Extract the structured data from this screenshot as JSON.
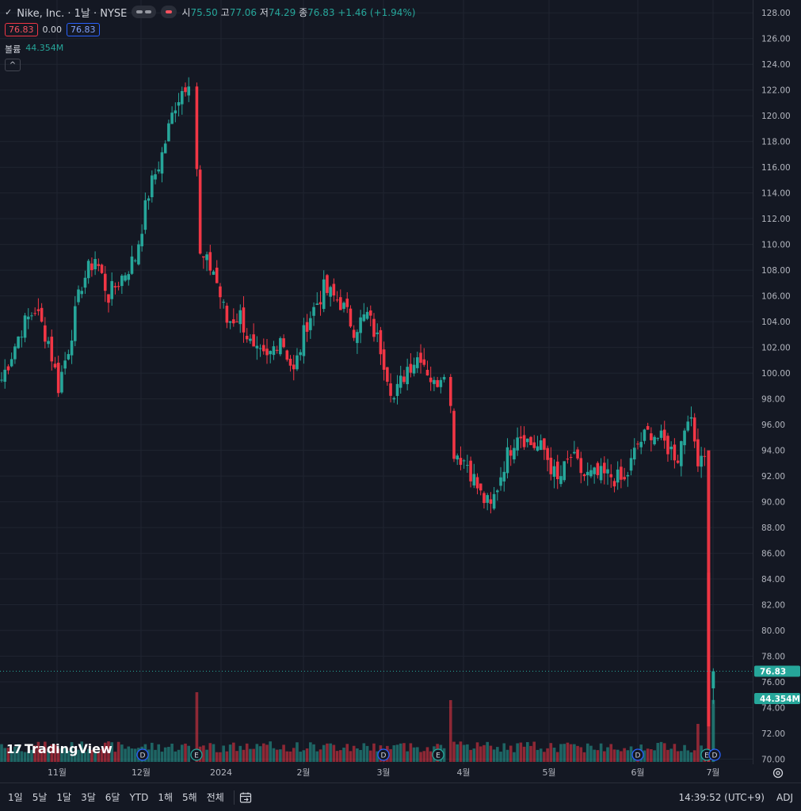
{
  "header": {
    "title": "Nike, Inc. · 1날 · NYSE",
    "ohlc": [
      {
        "k": "시",
        "v": "75.50"
      },
      {
        "k": "고",
        "v": "77.06"
      },
      {
        "k": "저",
        "v": "74.29"
      },
      {
        "k": "종",
        "v": "76.83"
      }
    ],
    "change": "+1.46 (+1.94%)",
    "bid": "76.83",
    "spread": "0.00",
    "ask": "76.83",
    "volume_label": "볼륨",
    "volume_value": "44.354M",
    "collapse_glyph": "^"
  },
  "colors": {
    "up": "#26a69a",
    "down": "#f23645",
    "background": "#141823",
    "grid": "#1f2430"
  },
  "price_axis": {
    "ticks": [
      "128.00",
      "126.00",
      "124.00",
      "122.00",
      "120.00",
      "118.00",
      "116.00",
      "114.00",
      "112.00",
      "110.00",
      "108.00",
      "106.00",
      "104.00",
      "102.00",
      "100.00",
      "98.00",
      "96.00",
      "94.00",
      "92.00",
      "90.00",
      "88.00",
      "86.00",
      "84.00",
      "82.00",
      "80.00",
      "78.00",
      "76.00",
      "74.00",
      "72.00",
      "70.00"
    ],
    "last_price_label": "76.83",
    "last_volume_label": "44.354M"
  },
  "time_axis": {
    "labels": [
      "11월",
      "12월",
      "2024",
      "2월",
      "3월",
      "4월",
      "5월",
      "6월",
      "7월"
    ]
  },
  "events": [
    {
      "type": "dividend",
      "glyph": "D"
    },
    {
      "type": "earnings",
      "glyph": "E"
    },
    {
      "type": "dividend",
      "glyph": "D"
    },
    {
      "type": "earnings",
      "glyph": "E"
    },
    {
      "type": "dividend",
      "glyph": "D"
    },
    {
      "type": "earnings",
      "glyph": "E"
    },
    {
      "type": "dividend",
      "glyph": "D"
    },
    {
      "type": "earnings",
      "glyph": "E"
    }
  ],
  "branding": {
    "logo_text": "TradingView",
    "logo_mark": "17"
  },
  "bottom_bar": {
    "ranges": [
      "1일",
      "5날",
      "1달",
      "3달",
      "6달",
      "YTD",
      "1해",
      "5해",
      "전체"
    ],
    "clock": "14:39:52 (UTC+9)",
    "adj": "ADJ",
    "goto_icon": "calendar-goto-icon",
    "settings_icon": "gear-icon"
  },
  "chart_data": {
    "type": "candlestick",
    "title": "",
    "symbol": "Nike, Inc.",
    "interval": "1날",
    "exchange": "NYSE",
    "ylim": [
      69.6,
      129.0
    ],
    "grid": true,
    "anchors": [
      [
        0,
        99.5
      ],
      [
        6,
        103.5
      ],
      [
        10,
        105.0
      ],
      [
        14,
        102.5
      ],
      [
        17,
        99.0
      ],
      [
        20,
        102.0
      ],
      [
        24,
        107.0
      ],
      [
        28,
        109.0
      ],
      [
        32,
        106.0
      ],
      [
        36,
        107.5
      ],
      [
        40,
        109.0
      ],
      [
        44,
        114.0
      ],
      [
        48,
        117.0
      ],
      [
        52,
        121.0
      ],
      [
        56,
        123.0
      ],
      [
        58,
        109.0
      ],
      [
        62,
        108.0
      ],
      [
        66,
        104.0
      ],
      [
        70,
        104.5
      ],
      [
        74,
        101.5
      ],
      [
        78,
        101.0
      ],
      [
        82,
        103.0
      ],
      [
        86,
        100.0
      ],
      [
        90,
        104.0
      ],
      [
        95,
        106.5
      ],
      [
        100,
        105.5
      ],
      [
        104,
        103.5
      ],
      [
        108,
        104.5
      ],
      [
        112,
        102.0
      ],
      [
        116,
        98.0
      ],
      [
        120,
        100.5
      ],
      [
        124,
        101.5
      ],
      [
        128,
        99.0
      ],
      [
        131,
        100.5
      ],
      [
        133,
        94.0
      ],
      [
        137,
        93.0
      ],
      [
        141,
        90.5
      ],
      [
        144,
        89.5
      ],
      [
        148,
        93.0
      ],
      [
        152,
        95.5
      ],
      [
        156,
        94.5
      ],
      [
        160,
        94.0
      ],
      [
        164,
        91.5
      ],
      [
        168,
        93.5
      ],
      [
        172,
        92.0
      ],
      [
        176,
        92.0
      ],
      [
        180,
        92.0
      ],
      [
        184,
        91.5
      ],
      [
        188,
        94.5
      ],
      [
        192,
        95.5
      ],
      [
        196,
        94.5
      ],
      [
        200,
        93.5
      ],
      [
        203,
        97.0
      ],
      [
        206,
        93.5
      ],
      [
        208,
        94.0
      ]
    ],
    "last_candle": {
      "open": 75.5,
      "high": 77.06,
      "low": 74.29,
      "close": 76.83,
      "volume": "44.354M"
    },
    "volume_series_name": "볼륨"
  }
}
